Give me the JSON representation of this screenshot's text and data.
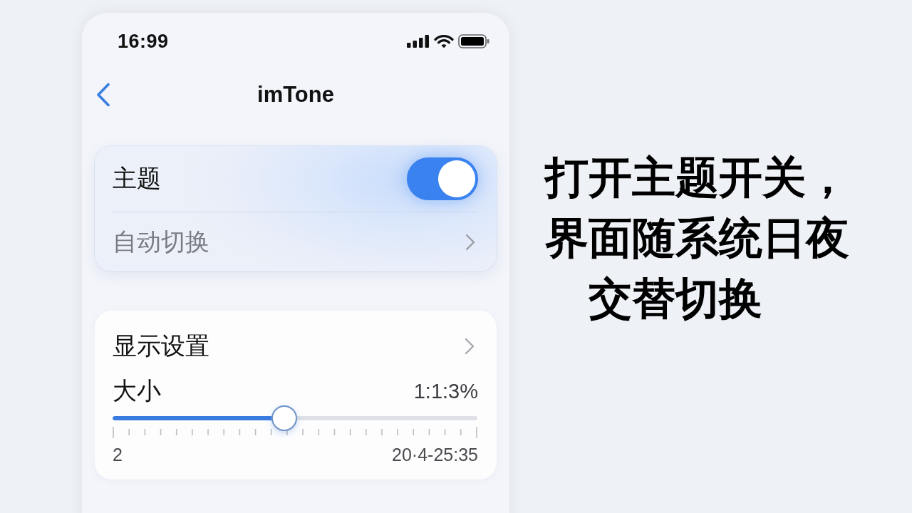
{
  "status_bar": {
    "time": "16:99"
  },
  "nav": {
    "title": "imTone"
  },
  "theme_card": {
    "rows": [
      {
        "kind": "toggle",
        "label": "主题",
        "on": true
      },
      {
        "kind": "link",
        "label": "自动切换",
        "disabled": true
      }
    ]
  },
  "display_card": {
    "title": "显示设置",
    "slider": {
      "label": "大小",
      "reading": "1:1:3%",
      "level": 0.47,
      "min_label": "2",
      "max_label": "20·4-25:35"
    }
  },
  "caption": {
    "lines": [
      "打开主题开关，",
      "界面随系统日夜",
      "交替切换"
    ]
  }
}
